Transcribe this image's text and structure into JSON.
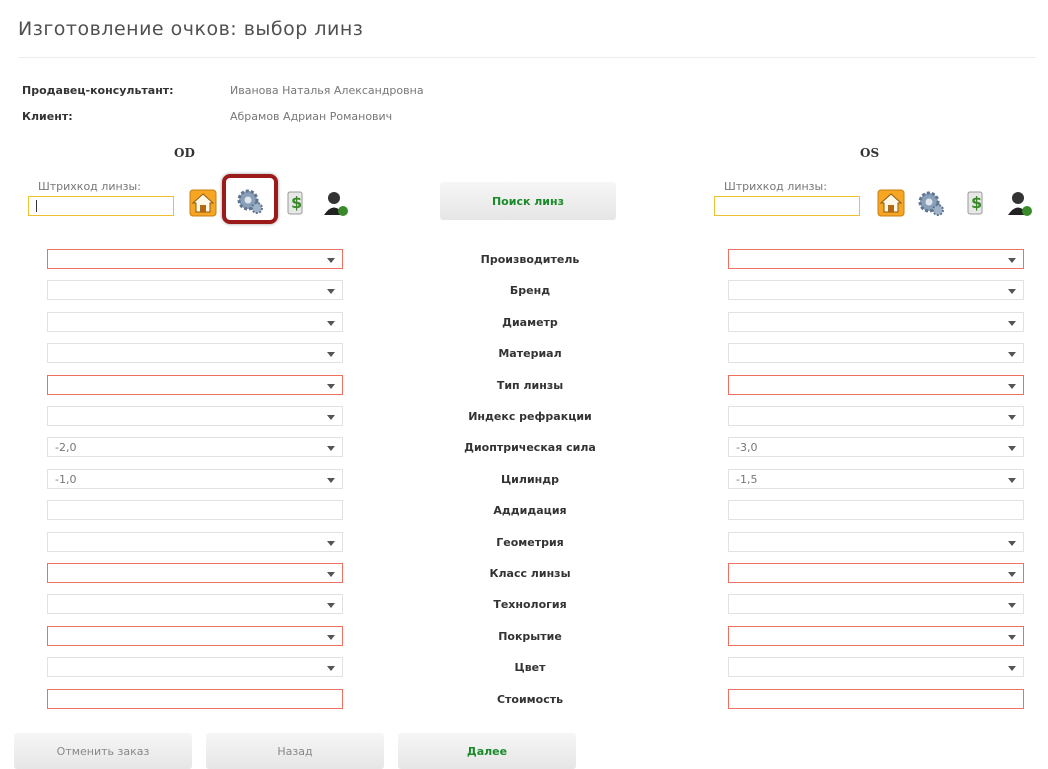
{
  "page": {
    "title": "Изготовление очков: выбор линз"
  },
  "info": {
    "seller_label": "Продавец-консультант:",
    "seller_value": "Иванова Наталья Александровна",
    "client_label": "Клиент:",
    "client_value": "Абрамов Адриан Романович"
  },
  "od": {
    "title": "OD",
    "barcode_label": "Штрихкод линзы:",
    "barcode_value": ""
  },
  "os": {
    "title": "OS",
    "barcode_label": "Штрихкод линзы:",
    "barcode_value": ""
  },
  "search_button": "Поиск линз",
  "icons": [
    "home-icon",
    "settings-gear-icon",
    "price-icon",
    "user-icon"
  ],
  "colors": {
    "accent_green": "#1b8a2a",
    "required_border": "#ee7060",
    "barcode_border": "#f0c030",
    "highlight": "#9b1b1b"
  },
  "rows": [
    {
      "label": "Производитель",
      "od": "",
      "os": "",
      "required": true,
      "dropdown": true
    },
    {
      "label": "Бренд",
      "od": "",
      "os": "",
      "required": false,
      "dropdown": true
    },
    {
      "label": "Диаметр",
      "od": "",
      "os": "",
      "required": false,
      "dropdown": true
    },
    {
      "label": "Материал",
      "od": "",
      "os": "",
      "required": false,
      "dropdown": true
    },
    {
      "label": "Тип линзы",
      "od": "",
      "os": "",
      "required": true,
      "dropdown": true
    },
    {
      "label": "Индекс рефракции",
      "od": "",
      "os": "",
      "required": false,
      "dropdown": true
    },
    {
      "label": "Диоптрическая сила",
      "od": "-2,0",
      "os": "-3,0",
      "required": false,
      "dropdown": true
    },
    {
      "label": "Цилиндр",
      "od": "-1,0",
      "os": "-1,5",
      "required": false,
      "dropdown": true
    },
    {
      "label": "Аддидация",
      "od": "",
      "os": "",
      "required": false,
      "dropdown": false
    },
    {
      "label": "Геометрия",
      "od": "",
      "os": "",
      "required": false,
      "dropdown": true
    },
    {
      "label": "Класс линзы",
      "od": "",
      "os": "",
      "required": true,
      "dropdown": true
    },
    {
      "label": "Технология",
      "od": "",
      "os": "",
      "required": false,
      "dropdown": true
    },
    {
      "label": "Покрытие",
      "od": "",
      "os": "",
      "required": true,
      "dropdown": true
    },
    {
      "label": "Цвет",
      "od": "",
      "os": "",
      "required": false,
      "dropdown": true
    },
    {
      "label": "Стоимость",
      "od": "",
      "os": "",
      "required": true,
      "dropdown": false
    }
  ],
  "footer": {
    "cancel": "Отменить заказ",
    "back": "Назад",
    "next": "Далее"
  }
}
